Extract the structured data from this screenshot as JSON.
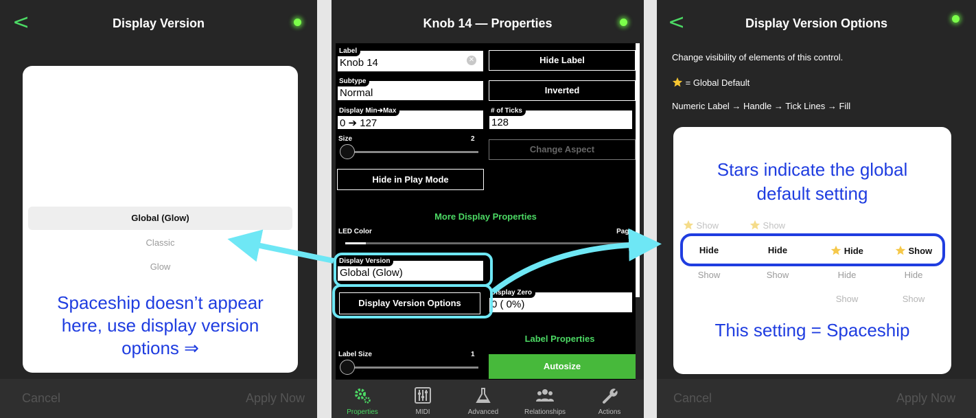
{
  "panel_left": {
    "title": "Display Version",
    "back_icon": "chevron-left-icon",
    "picker_options": [
      "Global (Glow)",
      "Classic",
      "Glow"
    ],
    "selected_option": "Global (Glow)",
    "note_line1": "Spaceship doesn’t appear",
    "note_line2": "here, use display version",
    "note_line3": "options ⇒",
    "cancel": "Cancel",
    "apply": "Apply Now"
  },
  "panel_mid": {
    "title": "Knob 14 — Properties",
    "label_field": {
      "tag": "Label",
      "value": "Knob 14"
    },
    "hide_label_button": "Hide Label",
    "subtype_field": {
      "tag": "Subtype",
      "value": "Normal"
    },
    "inverted_button": "Inverted",
    "display_minmax_field": {
      "tag": "Display Min➔Max",
      "value": "0 ➔ 127"
    },
    "ticks_field": {
      "tag": "# of Ticks",
      "value": "128"
    },
    "size_label": "Size",
    "size_value": "2",
    "change_aspect_button": "Change Aspect",
    "hide_play_mode_button": "Hide in Play Mode",
    "more_display_header": "More Display Properties",
    "led_color_label": "LED Color",
    "page_label": "Page",
    "display_version_field": {
      "tag": "Display Version",
      "value": "Global (Glow)"
    },
    "display_version_options_button": "Display Version Options",
    "display_zero_field": {
      "tag": "Display Zero",
      "value": "0 (  0%)"
    },
    "label_properties_header": "Label Properties",
    "label_size_label": "Label Size",
    "label_size_value": "1",
    "autosize_button": "Autosize",
    "tabs": [
      {
        "label": "Properties",
        "icon": "gears-icon",
        "active": true
      },
      {
        "label": "MIDI",
        "icon": "mixer-icon",
        "active": false
      },
      {
        "label": "Advanced",
        "icon": "flask-icon",
        "active": false
      },
      {
        "label": "Relationships",
        "icon": "people-icon",
        "active": false
      },
      {
        "label": "Actions",
        "icon": "wrench-icon",
        "active": false
      }
    ]
  },
  "panel_right": {
    "title": "Display Version Options",
    "back_icon": "chevron-left-icon",
    "line1": "Change visibility of elements of this control.",
    "line2": "= Global Default",
    "line3": "Numeric Label → Handle → Tick Lines → Fill",
    "callout": [
      "Stars indicate the global",
      "default setting"
    ],
    "grid": {
      "row_above": [
        "Show",
        "Show",
        "",
        ""
      ],
      "selected_row": [
        "Hide",
        "Hide",
        "Hide",
        "Show"
      ],
      "row_below": [
        "Show",
        "Show",
        "Hide",
        "Hide"
      ],
      "row_last": [
        "",
        "",
        "Show",
        "Show"
      ]
    },
    "starred_above": [
      true,
      true
    ],
    "starred_selected": [
      false,
      false,
      true,
      true
    ],
    "footer_note": "This setting = Spaceship",
    "cancel": "Cancel",
    "apply": "Apply Now"
  },
  "colors": {
    "accent_green": "#4cd964",
    "annotation_blue": "#1f3de0",
    "annotation_cyan": "#6ee7f5"
  }
}
